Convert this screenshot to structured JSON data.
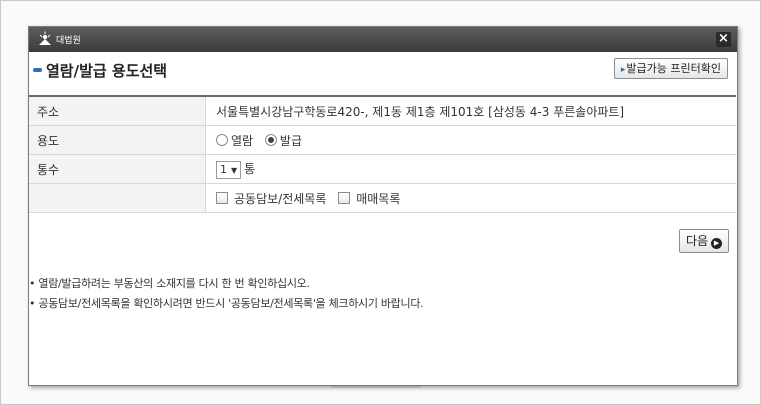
{
  "dialog": {
    "logo_text": "대법원",
    "close_label": "×",
    "title": "열람/발급 용도선택",
    "printer_button": "발급가능 프린터확인",
    "printer_arrow": "▸"
  },
  "form": {
    "address_label": "주소",
    "address_value": "서울특별시강남구학동로420-, 제1동 제1층 제101호 [삼성동 4-3 푸른솔아파트]",
    "purpose_label": "용도",
    "purpose_options": [
      "열람",
      "발급"
    ],
    "purpose_selected": "발급",
    "copies_label": "통수",
    "copies_value": "1",
    "copies_unit": "통",
    "copies_caret": "▼",
    "extra_options": [
      "공동담보/전세목록",
      "매매목록"
    ]
  },
  "next_button": {
    "label": "다음",
    "icon": "▶"
  },
  "notes": [
    "• 열람/발급하려는 부동산의 소재지를 다시 한 번 확인하십시오.",
    "• 공동담보/전세목록을 확인하시려면 반드시 '공동담보/전세목록'을 체크하시기 바랍니다."
  ],
  "colors": {
    "accent": "#2b6fb6",
    "titlebar": "#4a4a4a"
  }
}
